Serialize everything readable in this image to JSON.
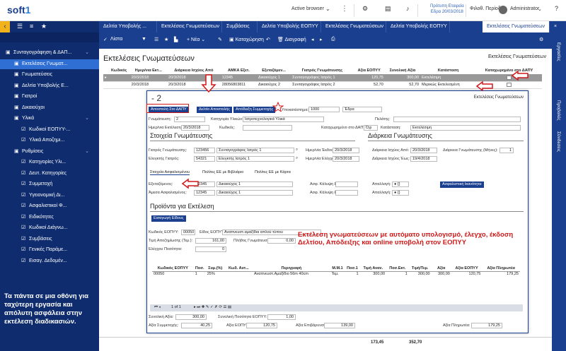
{
  "app": {
    "logo_prefix": "soft",
    "logo_suffix": "1",
    "active_browser": "Active browser",
    "company_line1": "Πρότυπη Εταιρεία",
    "company_line2": "Εδρα 20/03/2018",
    "period": "Φιλοθ. Περίοδος",
    "user": "Administrator"
  },
  "tabs": [
    "Δελτία Υποβολής ...",
    "Εκτελέσεις Γνωματεύσεων",
    "Συμβάσεις",
    "Δελτία Υποβολής ΕΟΠΥΥ",
    "Εκτελέσεις Γνωματεύσεων",
    "Δελτία Υποβολής ΕΟΠΥΥ",
    "Εκτελέσεις Γνωματεύσεων"
  ],
  "toolbar": {
    "new": "Νέα",
    "save": "Καταχώρηση",
    "delete": "Διαγραφή"
  },
  "sidebar": {
    "items": [
      {
        "label": "Συνταγογράφηση & ΔΑΠ...",
        "level": 0,
        "active": false,
        "chev": "⌄"
      },
      {
        "label": "Εκτελέσεις Γνωματ...",
        "level": 1,
        "active": true,
        "chev": ""
      },
      {
        "label": "Γνωματεύσεις",
        "level": 1,
        "active": false,
        "chev": ""
      },
      {
        "label": "Δελτία Υποβολής Ε...",
        "level": 1,
        "active": false,
        "chev": ""
      },
      {
        "label": "Γιατροί",
        "level": 1,
        "active": false,
        "chev": ""
      },
      {
        "label": "Δικαιούχοι",
        "level": 1,
        "active": false,
        "chev": ""
      },
      {
        "label": "Υλικά",
        "level": 1,
        "active": false,
        "chev": "⌄"
      },
      {
        "label": "Κωδικοί ΕΟΠΥΥ-...",
        "level": 2,
        "active": false,
        "chev": ""
      },
      {
        "label": "Υλικά Αποζημι...",
        "level": 2,
        "active": false,
        "chev": ""
      },
      {
        "label": "Ρυθμίσεις",
        "level": 1,
        "active": false,
        "chev": "⌄"
      },
      {
        "label": "Κατηγορίες Υλι...",
        "level": 2,
        "active": false,
        "chev": ""
      },
      {
        "label": "Δευτ. Κατηγορίες",
        "level": 2,
        "active": false,
        "chev": ""
      },
      {
        "label": "Συμμετοχή",
        "level": 2,
        "active": false,
        "chev": ""
      },
      {
        "label": "Υγειονομική Δι...",
        "level": 2,
        "active": false,
        "chev": ""
      },
      {
        "label": "Ασφαλιστικοί Φ...",
        "level": 2,
        "active": false,
        "chev": ""
      },
      {
        "label": "Ειδικότητες",
        "level": 2,
        "active": false,
        "chev": ""
      },
      {
        "label": "Κωδικοί Διάγνω...",
        "level": 2,
        "active": false,
        "chev": ""
      },
      {
        "label": "Συμβάσεις",
        "level": 2,
        "active": false,
        "chev": ""
      },
      {
        "label": "Γενικές Παράμε...",
        "level": 2,
        "active": false,
        "chev": ""
      },
      {
        "label": "Εισαγ. Δεδομέν...",
        "level": 2,
        "active": false,
        "chev": ""
      }
    ],
    "caption": "Τα πάντα σε μια οθόνη για ταχύτερη εργασία και απόλυτη ασφάλεια στην εκτέλεση διαδικασιών."
  },
  "rail": [
    "Εργασίες",
    "Προβολές",
    "Σύνδεσεις"
  ],
  "main": {
    "title": "Εκτελέσεις Γνωματεύσεων",
    "title_right": "Εκτελέσεις Γνωματεύσεων",
    "columns": [
      "Κωδικός",
      "Ημερ/νια Εκτ...",
      "Διάρκεια Ισχύος Από",
      "ΑΜΚΑ Εξετ.",
      "Εξεταζόμεν...",
      "Γιατρός Γνωμάτευσης",
      "Αξία ΕΟΠΥΥ",
      "Συνολική Αξία",
      "Κατάσταση",
      "Καταχωρημένο στο ΔΑΠΥ"
    ],
    "rows": [
      [
        "",
        "20/3/2018",
        "20/3/2018",
        "12345",
        "Δικαιούχος 1",
        "Συνταγογράφος Ιατρός 1",
        "120,75",
        "300,00",
        "Εκτελέσιμη",
        ""
      ],
      [
        "",
        "20/3/2018",
        "20/3/2018",
        "28056803811",
        "Δικαιούχος 2",
        "Συνταγογράφος Ιατρός 2",
        "52,70",
        "52,70",
        "Μερικώς Εκτελεσμένη",
        ""
      ]
    ],
    "total_eopyy": "173,45",
    "total_all": "352,70"
  },
  "dialog": {
    "number": "- 2",
    "title_right": "Εκτελέσεις Γνωματεύσεων",
    "btn_send": "Αποστολή Στο ΔΑΠΥ",
    "btn_delivery": "Δελτίο Αποστολής",
    "btn_receipt": "Απόδειξη Συμμετοχής",
    "label_subtype": "Υποκατάστημα:",
    "subtype_code": "1000",
    "subtype_name": "Έδρα",
    "label_opinion": "Γνωμάτευση:",
    "opinion_val": "2",
    "label_category": "Κατηγορία Υλικών:",
    "category_val": "Ιατροτεχνολογικά Υλικά",
    "label_client": "Πελάτης:",
    "label_exec_date": "Ημερ/νια Εκτέλεσης:",
    "exec_date": "20/3/2018",
    "label_code": "Κωδικός:",
    "label_reg_dapy": "Καταχωρημένο στο ΔΑΠΥ:",
    "reg_dapy_val": "Όχι",
    "label_status": "Κατάσταση:",
    "status_val": "Εκτελέσιμη",
    "sec_opinion": "Στοιχεία Γνωμάτευσης",
    "sec_duration": "Διάρκεια Γνωμάτευσης",
    "label_doctor": "Γιατρός Γνωμάτευσης:",
    "doctor_code": "123456",
    "doctor_name": "Συνταγογράφος Ιατρός 1",
    "label_checker": "Ελεγκτής Γιατρός:",
    "checker_code": "54321",
    "checker_name": "Ελεγκτής Ιατρός 1",
    "label_issue": "Ημερ/νία Έκδοσης:",
    "issue_date": "20/3/2018",
    "label_check_date": "Ημερ/νία Ελέγχου:",
    "check_date": "20/3/2018",
    "label_from": "Διάρκεια Ισχύος Από:",
    "from_date": "20/3/2018",
    "label_duration_months": "Διάρκεια Γνωμάτευσης (Μήνες):",
    "duration_months": "1",
    "label_to": "Διάρκεια Ισχύος Έως:",
    "to_date": "19/4/2018",
    "subtabs": [
      "Στοιχεία Ασφαλισμένου",
      "Πολίτες ΕΕ με Βιβλιάριο",
      "Πολίτες ΕΕ με Κάρτα"
    ],
    "label_examined": "Εξεταζόμενος:",
    "examined_code": "12345",
    "examined_name": "Δικαιούχος 1",
    "label_direct": "Άμεσα Ασφαλισμένος:",
    "direct_code": "12345",
    "direct_name": "Δικαιούχος 1",
    "label_coverage": "Ασφ. Κάλυψη Εως:",
    "label_exempt": "Απαλλαγή:",
    "btn_capacity": "Ασφαλιστική Ικανότητα",
    "sec_products": "Προϊόντα για Εκτέλεση",
    "btn_add_type": "Εισαγωγή Είδους",
    "label_eopyy_code": "Κωδικός ΕΟΠΥΥ:",
    "eopyy_code": "00050",
    "label_eopyy_type": "Είδος ΕΟΠΥΥ:",
    "eopyy_type": "Αναπνευστ.αμαξίδια απλού τύπου",
    "label_unit_price": "Τιμή Αποζημίωσης (Τεμ.):",
    "unit_price": "161,00",
    "label_opinion_qty": "Πλήθος Γνωμάτευσης:",
    "opinion_qty": "0,00",
    "label_control_qty": "Ελέγχου Ποσότητα:",
    "control_qty": "0",
    "grid_cols": [
      "Κωδικός ΕΟΠΥΥ",
      "Ποσ.",
      "Συμ.(%)",
      "Κωδ. Αυτ...",
      "Περιγραφή",
      "Μ.Μ.1",
      "Ποσ.1",
      "Τιμή Αναν.",
      "Ποσ.Εκτ.",
      "Τιμή/Τεμ.",
      "Αξία",
      "Αξία ΕΟΠΥΥ",
      "Αξία Πληρωτέα"
    ],
    "grid_row": [
      "00050",
      "1",
      "25%",
      "",
      "Αναπνευστ.Αμαξίδιο 56m 40cm",
      "Τεμ.",
      "1",
      "300,00",
      "1",
      "300,00",
      "300,00",
      "120,75",
      "179,25"
    ],
    "pager": "1 of 1",
    "label_total": "Συνολική Αξία:",
    "total": "300,00",
    "label_total_eopyy": "Συνολική Ποσότητα ΕΟΠΥΥ:",
    "total_eopyy_qty": "1,00",
    "label_participation": "Αξία Συμμετοχής:",
    "participation": "40,25",
    "label_eopyy_val": "Αξία ΕΟΠΥΥ:",
    "eopyy_val": "120,75",
    "label_burden": "Αξία Επιβάρυνσης:",
    "burden": "139,00",
    "label_payable": "Αξία Πληρωτέα:",
    "payable": "179,25"
  },
  "promo": "Εκτέλεση γνωματεύσεων με αυτόματο υπολογισμό, έλεγχο, έκδοση Δελτίου, Απόδειξης και online υποβολή στον ΕΟΠΥΥ",
  "colors": {
    "navy": "#0f2d6e",
    "blue": "#1b3f8f",
    "accent": "#2f6fd4",
    "gold": "#f2b21b",
    "red": "#d01818"
  }
}
